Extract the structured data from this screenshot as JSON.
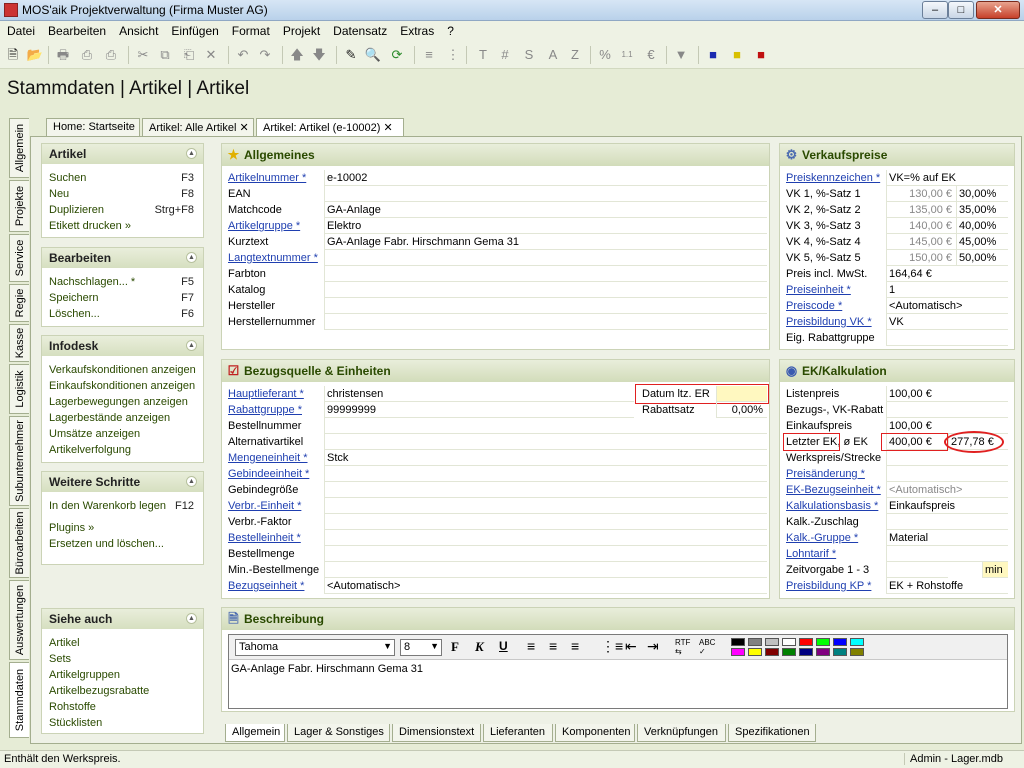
{
  "window": {
    "title": "MOS'aik Projektverwaltung (Firma Muster AG)",
    "min": "–",
    "max": "□",
    "close": "✕"
  },
  "menu": [
    "Datei",
    "Bearbeiten",
    "Ansicht",
    "Einfügen",
    "Format",
    "Projekt",
    "Datensatz",
    "Extras",
    "?"
  ],
  "page_title": "Stammdaten | Artikel | Artikel",
  "doc_tabs": [
    "Home: Startseite",
    "Artikel: Alle Artikel",
    "Artikel: Artikel (e-10002)"
  ],
  "vertical_tabs": [
    "Allgemein",
    "Projekte",
    "Service",
    "Regie",
    "Kasse",
    "Logistik",
    "Subunternehmer",
    "Büroarbeiten",
    "Auswertungen",
    "Stammdaten"
  ],
  "sidebar": {
    "artikel": {
      "title": "Artikel",
      "items": [
        {
          "label": "Suchen",
          "key": "F3"
        },
        {
          "label": "Neu",
          "key": "F8"
        },
        {
          "label": "Duplizieren",
          "key": "Strg+F8"
        },
        {
          "label": "Etikett drucken »",
          "key": ""
        }
      ]
    },
    "bearbeiten": {
      "title": "Bearbeiten",
      "items": [
        {
          "label": "Nachschlagen... *",
          "key": "F5"
        },
        {
          "label": "Speichern",
          "key": "F7"
        },
        {
          "label": "Löschen...",
          "key": "F6"
        }
      ]
    },
    "infodesk": {
      "title": "Infodesk",
      "items": [
        {
          "label": "Verkaufskonditionen anzeigen"
        },
        {
          "label": "Einkaufskonditionen anzeigen"
        },
        {
          "label": "Lagerbewegungen anzeigen"
        },
        {
          "label": "Lagerbestände anzeigen"
        },
        {
          "label": "Umsätze anzeigen"
        },
        {
          "label": "Artikelverfolgung"
        }
      ]
    },
    "weitere": {
      "title": "Weitere Schritte",
      "items": [
        {
          "label": "In den Warenkorb legen",
          "key": "F12"
        },
        {
          "label": "Plugins »",
          "key": ""
        },
        {
          "label": "Ersetzen und löschen...",
          "key": ""
        }
      ]
    },
    "siehe": {
      "title": "Siehe auch",
      "items": [
        {
          "label": "Artikel"
        },
        {
          "label": "Sets"
        },
        {
          "label": "Artikelgruppen"
        },
        {
          "label": "Artikelbezugsrabatte"
        },
        {
          "label": "Rohstoffe"
        },
        {
          "label": "Stücklisten"
        }
      ]
    }
  },
  "allgemeines": {
    "title": "Allgemeines",
    "rows": [
      {
        "label": "Artikelnummer *",
        "value": "e-10002",
        "link": true
      },
      {
        "label": "EAN",
        "value": ""
      },
      {
        "label": "Matchcode",
        "value": "GA-Anlage"
      },
      {
        "label": "Artikelgruppe *",
        "value": "Elektro",
        "link": true
      },
      {
        "label": "Kurztext",
        "value": "GA-Anlage Fabr. Hirschmann Gema 31"
      },
      {
        "label": "Langtextnummer *",
        "value": "",
        "link": true
      },
      {
        "label": "Farbton",
        "value": ""
      },
      {
        "label": "Katalog",
        "value": ""
      },
      {
        "label": "Hersteller",
        "value": ""
      },
      {
        "label": "Herstellernummer",
        "value": ""
      }
    ]
  },
  "verkaufspreise": {
    "title": "Verkaufspreise",
    "rows": [
      {
        "label": "Preiskennzeichen *",
        "value": "VK=% auf EK",
        "link": true
      },
      {
        "label": "VK 1, %-Satz 1",
        "value": "130,00 €",
        "pct": "30,00%"
      },
      {
        "label": "VK 2, %-Satz 2",
        "value": "135,00 €",
        "pct": "35,00%"
      },
      {
        "label": "VK 3, %-Satz 3",
        "value": "140,00 €",
        "pct": "40,00%"
      },
      {
        "label": "VK 4, %-Satz 4",
        "value": "145,00 €",
        "pct": "45,00%"
      },
      {
        "label": "VK 5, %-Satz 5",
        "value": "150,00 €",
        "pct": "50,00%"
      },
      {
        "label": "Preis incl. MwSt.",
        "value": "164,64 €"
      },
      {
        "label": "Preiseinheit *",
        "value": "1",
        "link": true
      },
      {
        "label": "Preiscode *",
        "value": "<Automatisch>",
        "link": true
      },
      {
        "label": "Preisbildung VK *",
        "value": "VK",
        "link": true
      },
      {
        "label": "Eig. Rabattgruppe",
        "value": ""
      }
    ]
  },
  "bezugsquelle": {
    "title": "Bezugsquelle & Einheiten",
    "rows": [
      {
        "label": "Hauptlieferant *",
        "value": "christensen",
        "link": true
      },
      {
        "label": "Rabattgruppe *",
        "value": "99999999",
        "link": true
      },
      {
        "label": "Bestellnummer",
        "value": ""
      },
      {
        "label": "Alternativartikel",
        "value": ""
      },
      {
        "label": "Mengeneinheit *",
        "value": "Stck",
        "link": true
      },
      {
        "label": "Gebindeeinheit *",
        "value": "",
        "link": true
      },
      {
        "label": "Gebindegröße",
        "value": ""
      },
      {
        "label": "Verbr.-Einheit *",
        "value": "",
        "link": true
      },
      {
        "label": "Verbr.-Faktor",
        "value": ""
      },
      {
        "label": "Bestelleinheit *",
        "value": "",
        "link": true
      },
      {
        "label": "Bestellmenge",
        "value": ""
      },
      {
        "label": "Min.-Bestellmenge",
        "value": ""
      },
      {
        "label": "Bezugseinheit *",
        "value": "<Automatisch>",
        "link": true
      }
    ],
    "datum_label": "Datum ltz. ER",
    "datum_value": "",
    "rabattsatz_label": "Rabattsatz",
    "rabattsatz_value": "0,00%"
  },
  "ek": {
    "title": "EK/Kalkulation",
    "rows": [
      {
        "label": "Listenpreis",
        "value": "100,00 €"
      },
      {
        "label": "Bezugs-, VK-Rabatt",
        "value": ""
      },
      {
        "label": "Einkaufspreis",
        "value": "100,00 €"
      },
      {
        "label": "Letzter EK, ø EK",
        "value": "400,00 €",
        "extra": "277,78 €"
      },
      {
        "label": "Werkspreis/Strecke",
        "value": ""
      },
      {
        "label": "Preisänderung *",
        "value": "",
        "link": true
      },
      {
        "label": "EK-Bezugseinheit *",
        "value": "<Automatisch>",
        "link": true,
        "gray": true
      },
      {
        "label": "Kalkulationsbasis *",
        "value": "Einkaufspreis",
        "link": true
      },
      {
        "label": "Kalk.-Zuschlag",
        "value": ""
      },
      {
        "label": "Kalk.-Gruppe *",
        "value": "Material",
        "link": true
      },
      {
        "label": "Lohntarif *",
        "value": "",
        "link": true
      },
      {
        "label": "Zeitvorgabe 1 - 3",
        "value": "",
        "extra": "min"
      },
      {
        "label": "Preisbildung KP *",
        "value": "EK + Rohstoffe",
        "link": true
      }
    ]
  },
  "beschreibung": {
    "title": "Beschreibung",
    "font": "Tahoma",
    "size": "8",
    "text": "GA-Anlage Fabr. Hirschmann Gema 31",
    "palette": [
      "#000000",
      "#808080",
      "#c0c0c0",
      "#ffffff",
      "#ff0000",
      "#00ff00",
      "#0000ff",
      "#00ffff",
      "#ff00ff",
      "#ffff00",
      "#800000",
      "#008000",
      "#000080",
      "#800080",
      "#008080",
      "#808000"
    ]
  },
  "bottom_tabs": [
    "Allgemein",
    "Lager & Sonstiges",
    "Dimensionstext",
    "Lieferanten",
    "Komponenten",
    "Verknüpfungen",
    "Spezifikationen"
  ],
  "status": {
    "left": "Enthält den Werkspreis.",
    "right": "Admin - Lager.mdb"
  }
}
